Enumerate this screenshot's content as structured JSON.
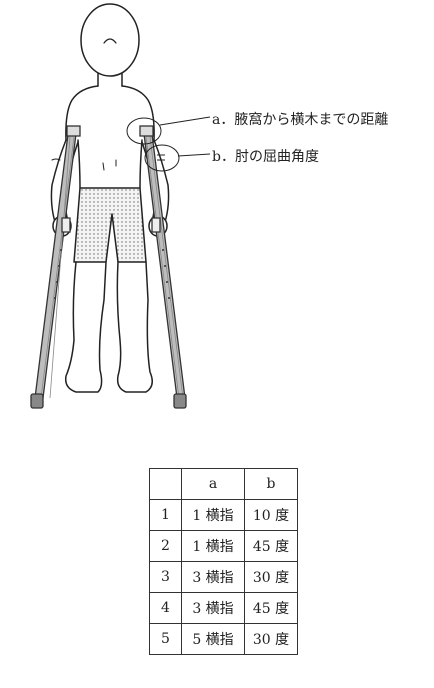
{
  "labels": {
    "a": "a．腋窩から横木までの距離",
    "b": "b．肘の屈曲角度"
  },
  "table": {
    "headers": [
      "",
      "a",
      "b"
    ],
    "rows": [
      [
        "1",
        "1 横指",
        "10 度"
      ],
      [
        "2",
        "1 横指",
        "45 度"
      ],
      [
        "3",
        "3 横指",
        "30 度"
      ],
      [
        "4",
        "3 横指",
        "45 度"
      ],
      [
        "5",
        "5 横指",
        "30 度"
      ]
    ]
  }
}
